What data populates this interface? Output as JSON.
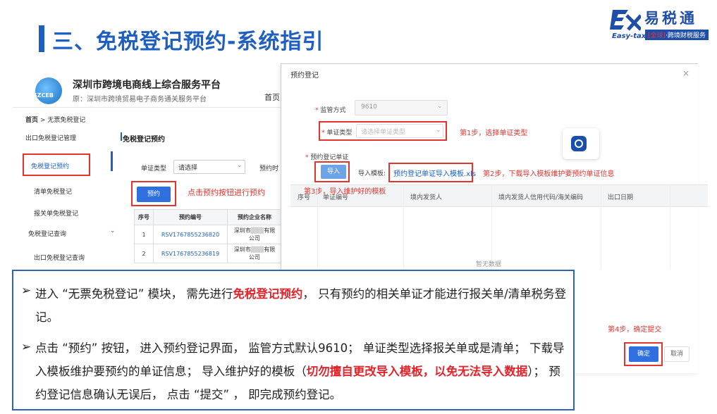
{
  "slide": {
    "title": "三、免税登记预约-系统指引"
  },
  "logo": {
    "name": "易税通",
    "en": "Easy-tax",
    "sub_prefix": "[全球]",
    "sub_suffix": "·跨境财税服务"
  },
  "portal": {
    "logo_text": "SZCEB",
    "name": "深圳市跨境电商线上综合服务平台",
    "old_name": "原：深圳市跨境贸易电子商务通关服务平台",
    "home": "首页",
    "breadcrumb_home": "首页",
    "breadcrumb_sep": ">",
    "breadcrumb_current": "无票免税登记",
    "sidebar": [
      "出口免税登记管理",
      "免税登记预约",
      "清单免税登记",
      "报关单免税登记",
      "免税登记查询",
      "出口免税登记查询"
    ],
    "content_title": "免税登记预约",
    "doc_type_label": "单证类型",
    "doc_type_value": "请选择",
    "reserve_cut": "预约时",
    "reserve_button": "预约",
    "reserve_note": "点击预约按钮进行预约",
    "table": {
      "headers": [
        "序号",
        "预约编号",
        "预约企业名称"
      ],
      "rows": [
        [
          "1",
          "RSV1767855236820",
          "深圳市",
          "有限",
          "公司"
        ],
        [
          "2",
          "RSV1767855236819",
          "深圳市",
          "有限",
          "公司"
        ]
      ]
    }
  },
  "modal": {
    "title": "预约登记",
    "close": "×",
    "supervision_label": "监管方式",
    "supervision_value": "9610",
    "cert_type_label": "单证类型",
    "cert_type_placeholder": "请选择单证类型",
    "step1": "第1步，选择单证类型",
    "appt_label": "预约登记单证",
    "import_button": "导入",
    "template_label": "导入模板:",
    "template_link": "预约登记单证导入模板.xls",
    "step2": "第2步，下载导入模板维护要预约单证信息",
    "step3": "第3步，导入维护好的模板",
    "columns": [
      "序号",
      "单证编号",
      "境内发货人",
      "境内发货人信用代码/海关编码",
      "出口日期"
    ],
    "empty": "暂无数据",
    "step4": "第4步，确定提交",
    "confirm_button": "确定",
    "cancel_button": "取消"
  },
  "notes": {
    "p1_a": "进入 “无票免税登记” 模块， 需先进行",
    "p1_hl": "免税登记预约",
    "p1_b": "， 只有预约的相关单证才能进行报关单/清单税务登记。",
    "p2_a": "点击 “预约” 按钮， 进入预约登记界面， 监管方式默认9610； 单证类型选择报关单或是清单； 下载导入模板维护要预约的单证信息； 导入维护好的模板（",
    "p2_hl": "切勿擅自更改导入模板，以免无法导入数据",
    "p2_b": "）； 预约登记信息确认无误后， 点击 “提交” ， 即完成预约登记。"
  },
  "colors": {
    "brand_blue": "#1f5fbf",
    "highlight_red": "#e3342f"
  }
}
